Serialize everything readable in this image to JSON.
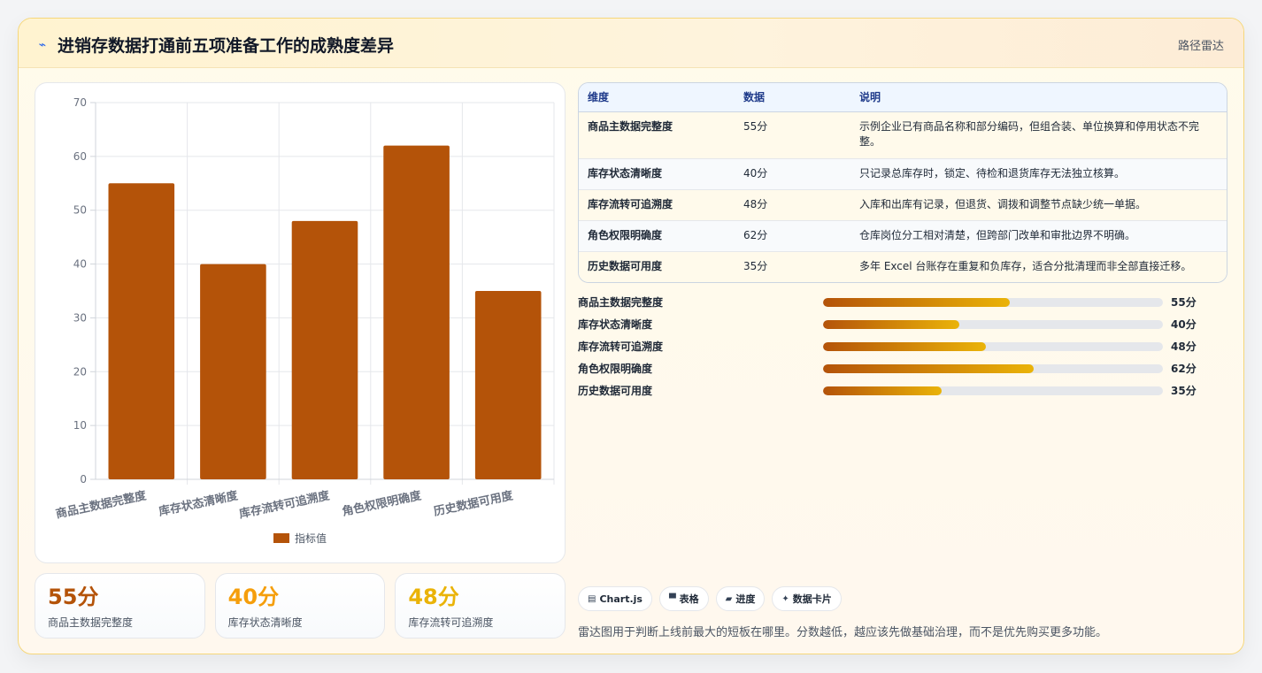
{
  "header": {
    "icon": "chart-line-icon",
    "title": "进销存数据打通前五项准备工作的成熟度差异",
    "tag": "路径雷达"
  },
  "colors": {
    "bar": "#b45309",
    "accent_orange": "#b45309",
    "accent_amber": "#f59e0b",
    "accent_gold": "#eab308"
  },
  "chart_data": {
    "type": "bar",
    "categories": [
      "商品主数据完整度",
      "库存状态清晰度",
      "库存流转可追溯度",
      "角色权限明确度",
      "历史数据可用度"
    ],
    "series": [
      {
        "name": "指标值",
        "values": [
          55,
          40,
          48,
          62,
          35
        ]
      }
    ],
    "ylim": [
      0,
      70
    ],
    "yticks": [
      0,
      10,
      20,
      30,
      40,
      50,
      60,
      70
    ],
    "grid": true,
    "legend_position": "bottom"
  },
  "legend": {
    "label": "指标值"
  },
  "stats": [
    {
      "value": "55分",
      "label": "商品主数据完整度",
      "color": "#b45309"
    },
    {
      "value": "40分",
      "label": "库存状态清晰度",
      "color": "#f59e0b"
    },
    {
      "value": "48分",
      "label": "库存流转可追溯度",
      "color": "#eab308"
    }
  ],
  "table": {
    "headers": [
      "维度",
      "数据",
      "说明"
    ],
    "rows": [
      [
        "商品主数据完整度",
        "55分",
        "示例企业已有商品名称和部分编码，但组合装、单位换算和停用状态不完整。"
      ],
      [
        "库存状态清晰度",
        "40分",
        "只记录总库存时，锁定、待检和退货库存无法独立核算。"
      ],
      [
        "库存流转可追溯度",
        "48分",
        "入库和出库有记录，但退货、调拨和调整节点缺少统一单据。"
      ],
      [
        "角色权限明确度",
        "62分",
        "仓库岗位分工相对清楚，但跨部门改单和审批边界不明确。"
      ],
      [
        "历史数据可用度",
        "35分",
        "多年 Excel 台账存在重复和负库存，适合分批清理而非全部直接迁移。"
      ]
    ]
  },
  "progress": [
    {
      "label": "商品主数据完整度",
      "value": "55分",
      "fraction": 0.55
    },
    {
      "label": "库存状态清晰度",
      "value": "40分",
      "fraction": 0.4
    },
    {
      "label": "库存流转可追溯度",
      "value": "48分",
      "fraction": 0.48
    },
    {
      "label": "角色权限明确度",
      "value": "62分",
      "fraction": 0.62
    },
    {
      "label": "历史数据可用度",
      "value": "35分",
      "fraction": 0.35
    }
  ],
  "chips": [
    {
      "icon": "chart-icon",
      "label": "Chart.js"
    },
    {
      "icon": "table-icon",
      "label": "表格"
    },
    {
      "icon": "progress-icon",
      "label": "进度"
    },
    {
      "icon": "sparkle-icon",
      "label": "数据卡片"
    }
  ],
  "footnote": "雷达图用于判断上线前最大的短板在哪里。分数越低，越应该先做基础治理，而不是优先购买更多功能。"
}
